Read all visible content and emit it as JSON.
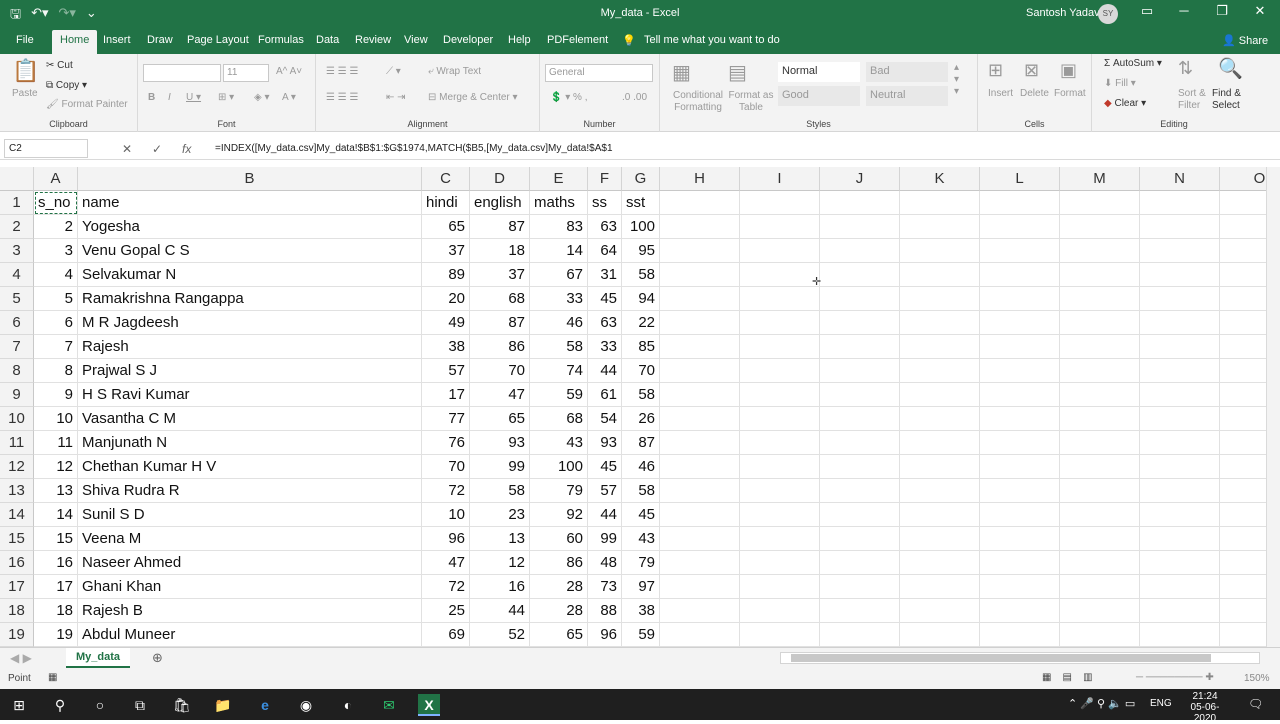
{
  "app": {
    "title": "My_data  -  Excel",
    "user": "Santosh Yadav",
    "user_initials": "SY"
  },
  "tabs": [
    "File",
    "Home",
    "Insert",
    "Draw",
    "Page Layout",
    "Formulas",
    "Data",
    "Review",
    "View",
    "Developer",
    "Help",
    "PDFelement"
  ],
  "tell_me": "Tell me what you want to do",
  "share": "Share",
  "ribbon": {
    "clipboard": {
      "label": "Clipboard",
      "paste": "Paste",
      "cut": "Cut",
      "copy": "Copy",
      "format_painter": "Format Painter"
    },
    "font": {
      "label": "Font",
      "size": "11"
    },
    "alignment": {
      "label": "Alignment",
      "wrap": "Wrap Text",
      "merge": "Merge & Center"
    },
    "number": {
      "label": "Number",
      "format": "General"
    },
    "styles": {
      "label": "Styles",
      "conditional": "Conditional Formatting",
      "format_as": "Format as Table",
      "normal": "Normal",
      "bad": "Bad",
      "good": "Good",
      "neutral": "Neutral"
    },
    "cells": {
      "label": "Cells",
      "insert": "Insert",
      "delete": "Delete",
      "format": "Format"
    },
    "editing": {
      "label": "Editing",
      "autosum": "AutoSum",
      "fill": "Fill",
      "clear": "Clear",
      "sort": "Sort & Filter",
      "find": "Find & Select"
    }
  },
  "name_box": "C2",
  "formula": "=INDEX([My_data.csv]My_data!$B$1:$G$1974,MATCH($B5,[My_data.csv]My_data!$A$1",
  "columns": [
    "A",
    "B",
    "C",
    "D",
    "E",
    "F",
    "G",
    "H",
    "I",
    "J",
    "K",
    "L",
    "M",
    "N",
    "O"
  ],
  "header": [
    "s_no",
    "name",
    "hindi",
    "english",
    "maths",
    "ss",
    "sst"
  ],
  "rows": [
    [
      "2",
      "Yogesha",
      "65",
      "87",
      "83",
      "63",
      "100"
    ],
    [
      "3",
      "Venu Gopal C S",
      "37",
      "18",
      "14",
      "64",
      "95"
    ],
    [
      "4",
      "Selvakumar N",
      "89",
      "37",
      "67",
      "31",
      "58"
    ],
    [
      "5",
      "Ramakrishna Rangappa",
      "20",
      "68",
      "33",
      "45",
      "94"
    ],
    [
      "6",
      "M R Jagdeesh",
      "49",
      "87",
      "46",
      "63",
      "22"
    ],
    [
      "7",
      "Rajesh",
      "38",
      "86",
      "58",
      "33",
      "85"
    ],
    [
      "8",
      "Prajwal S J",
      "57",
      "70",
      "74",
      "44",
      "70"
    ],
    [
      "9",
      "H S Ravi Kumar",
      "17",
      "47",
      "59",
      "61",
      "58"
    ],
    [
      "10",
      "Vasantha C M",
      "77",
      "65",
      "68",
      "54",
      "26"
    ],
    [
      "11",
      "Manjunath N",
      "76",
      "93",
      "43",
      "93",
      "87"
    ],
    [
      "12",
      "Chethan Kumar H V",
      "70",
      "99",
      "100",
      "45",
      "46"
    ],
    [
      "13",
      "Shiva Rudra R",
      "72",
      "58",
      "79",
      "57",
      "58"
    ],
    [
      "14",
      "Sunil S D",
      "10",
      "23",
      "92",
      "44",
      "45"
    ],
    [
      "15",
      "Veena M",
      "96",
      "13",
      "60",
      "99",
      "43"
    ],
    [
      "16",
      "Naseer Ahmed",
      "47",
      "12",
      "86",
      "48",
      "79"
    ],
    [
      "17",
      "Ghani Khan",
      "72",
      "16",
      "28",
      "73",
      "97"
    ],
    [
      "18",
      "Rajesh B",
      "25",
      "44",
      "28",
      "88",
      "38"
    ],
    [
      "19",
      "Abdul Muneer",
      "69",
      "52",
      "65",
      "96",
      "59"
    ]
  ],
  "sheet_tab": "My_data",
  "status": "Point",
  "zoom": "150%",
  "clock": {
    "time": "21:24",
    "date": "05-06-2020"
  },
  "lang": "ENG",
  "colors": {
    "excel_green": "#217346"
  }
}
